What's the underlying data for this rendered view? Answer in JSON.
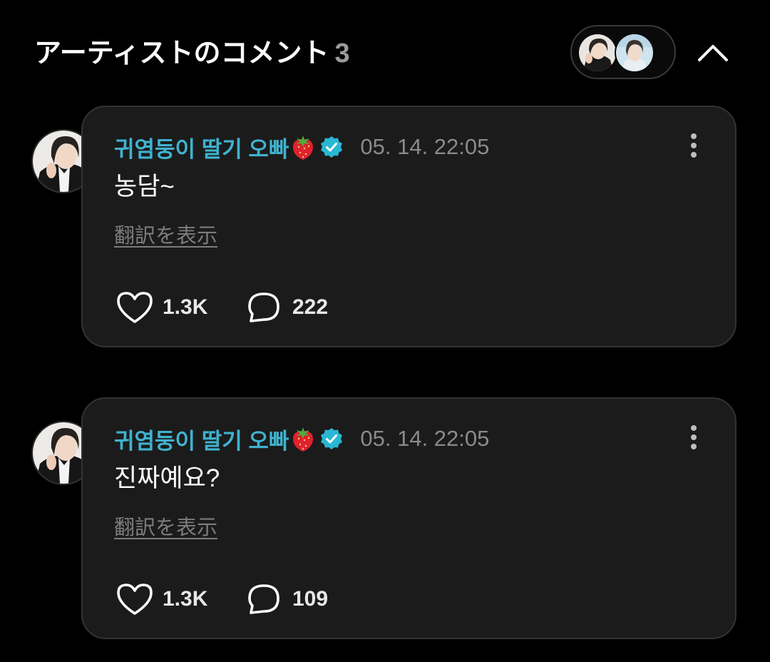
{
  "header": {
    "title": "アーティストのコメント",
    "count": "3"
  },
  "colors": {
    "background": "#000000",
    "card_background": "#1b1b1b",
    "author_color": "#3fb3cf",
    "verified_badge": "#29b7d3",
    "muted_text": "#8a8a8a"
  },
  "comments": [
    {
      "author": "귀염둥이 딸기 오빠",
      "author_emoji": "strawberry-icon",
      "verified": true,
      "timestamp": "05. 14. 22:05",
      "text": "농담~",
      "translate_label": "翻訳を表示",
      "likes": "1.3K",
      "replies": "222"
    },
    {
      "author": "귀염둥이 딸기 오빠",
      "author_emoji": "strawberry-icon",
      "verified": true,
      "timestamp": "05. 14. 22:05",
      "text": "진짜예요?",
      "translate_label": "翻訳を表示",
      "likes": "1.3K",
      "replies": "109"
    }
  ]
}
